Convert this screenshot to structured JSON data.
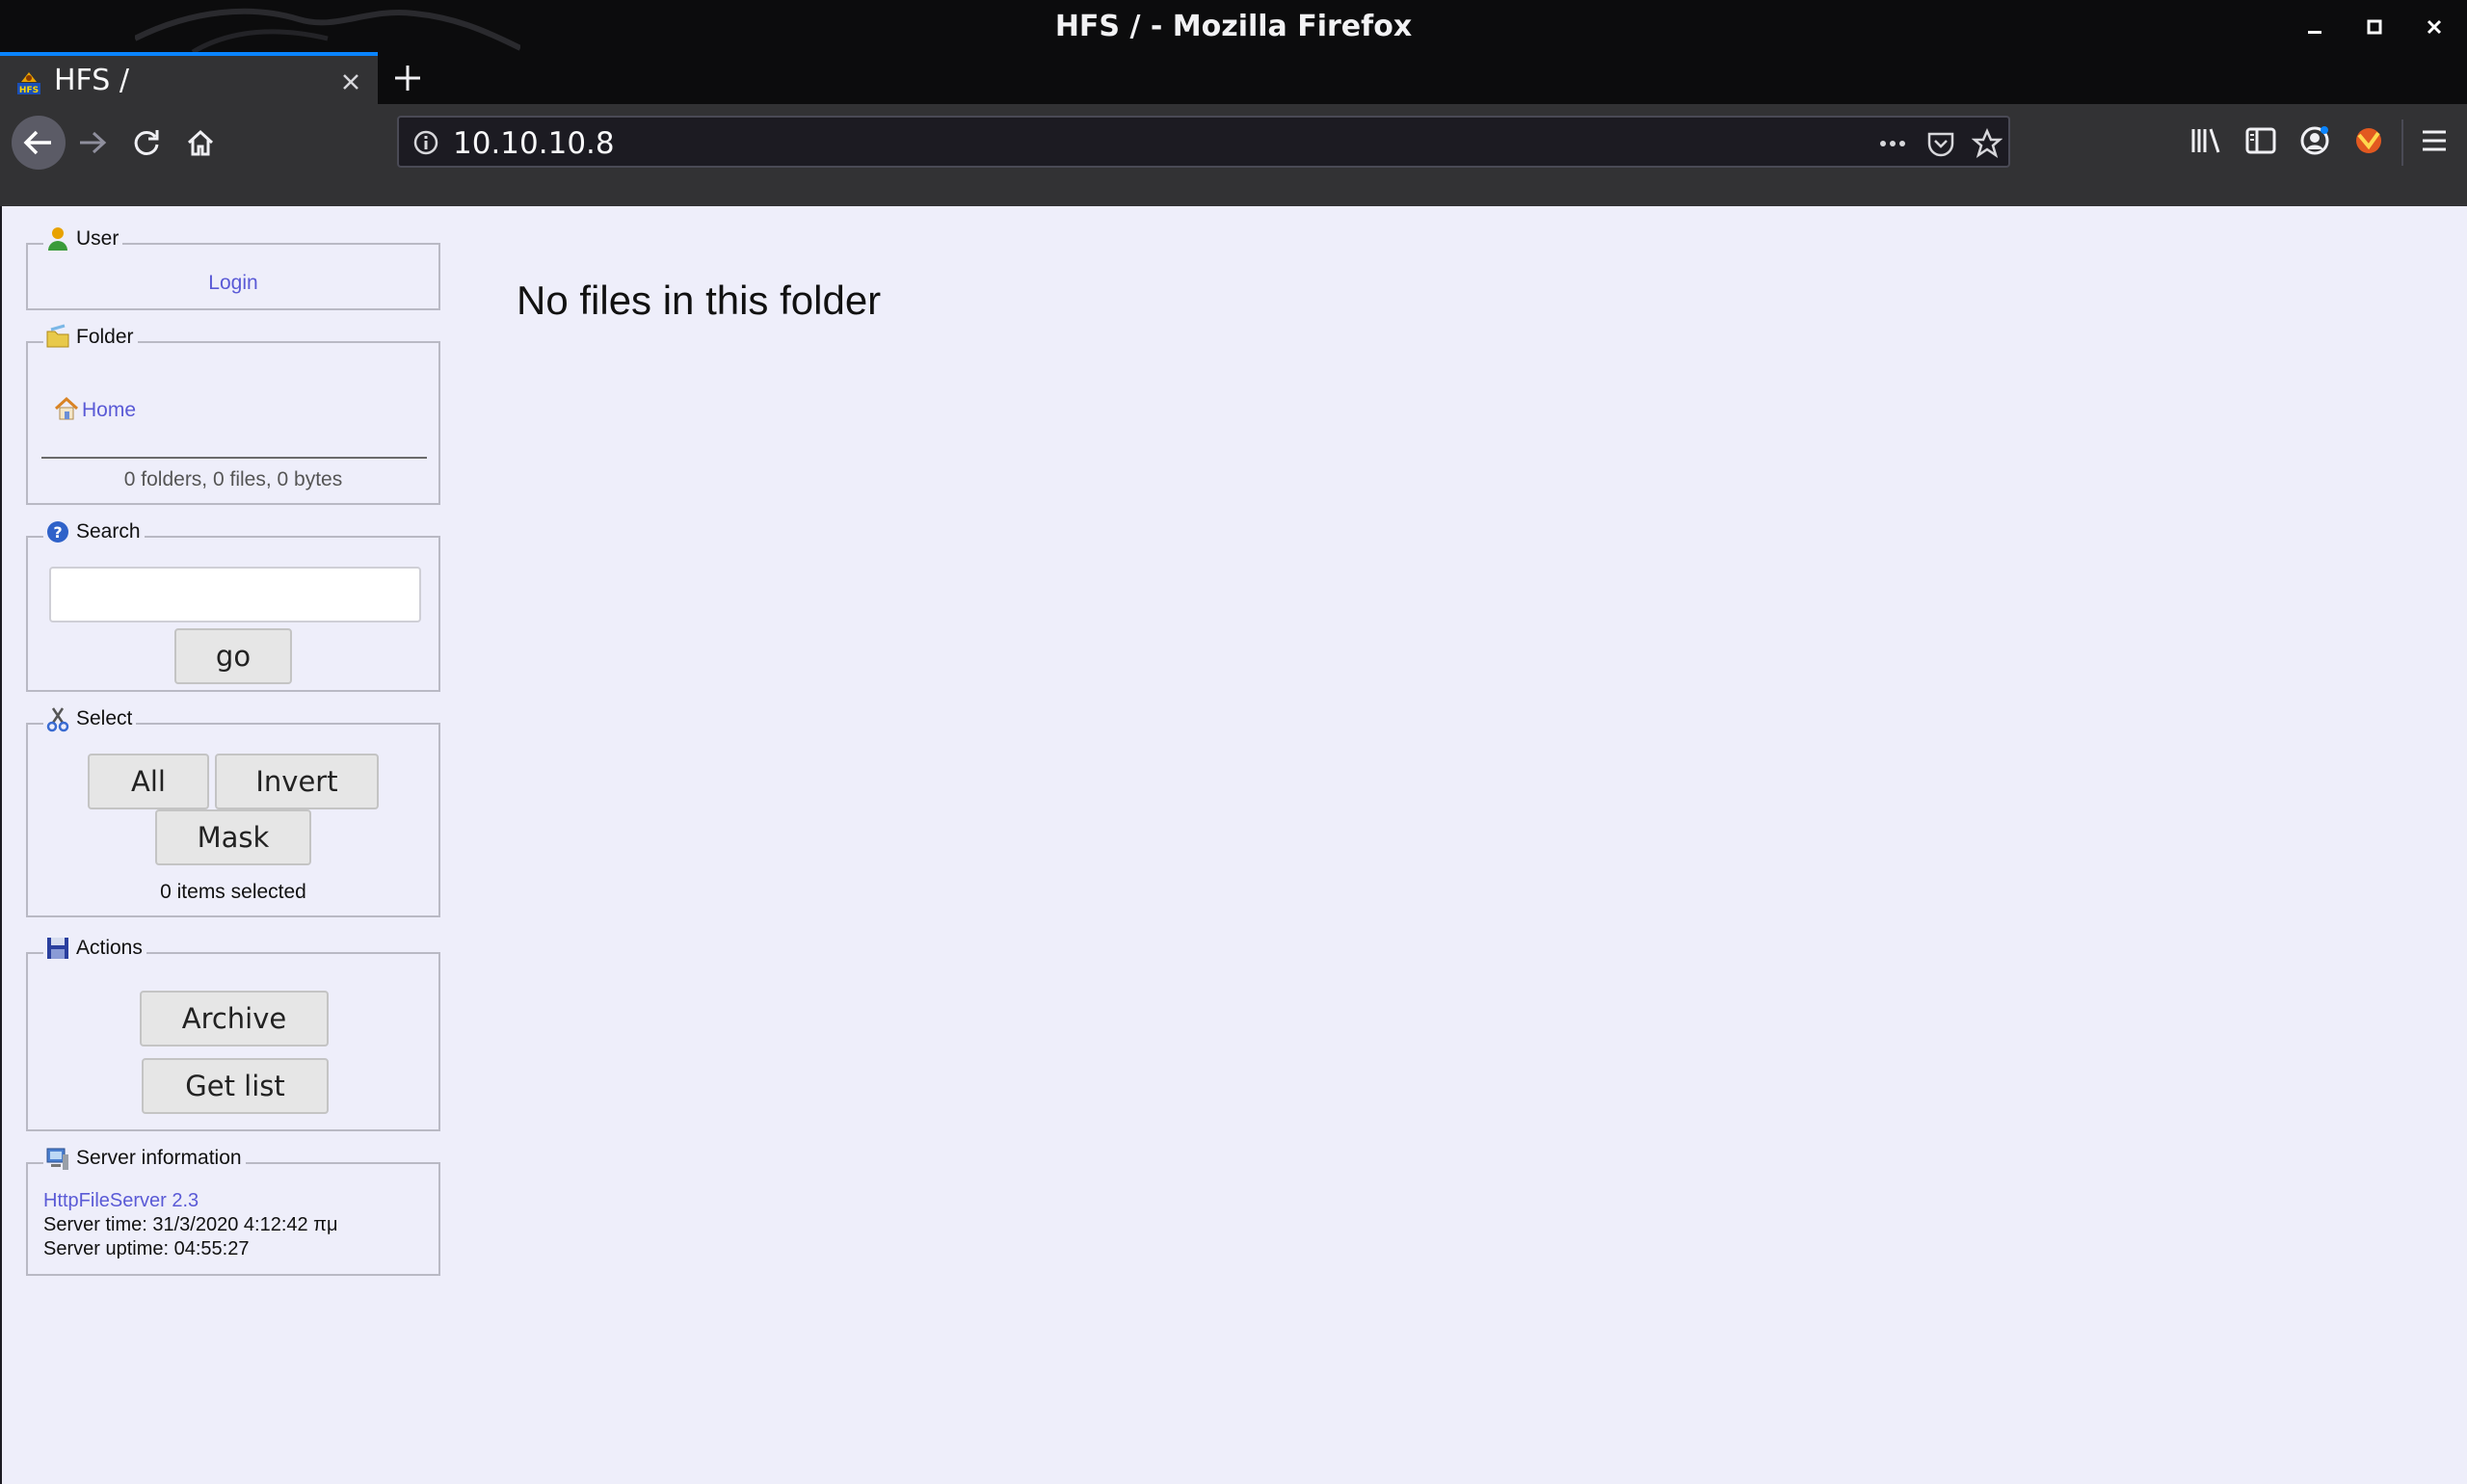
{
  "window": {
    "title": "HFS / - Mozilla Firefox"
  },
  "tab": {
    "title": "HFS /",
    "favicon_label": "HFS"
  },
  "urlbar": {
    "url": "10.10.10.8"
  },
  "colors": {
    "chrome_dark": "#0c0c0d",
    "toolbar": "#323234",
    "tab_accent": "#0a84ff",
    "page_bg": "#eeeefa",
    "link": "#5a5ad6"
  },
  "page": {
    "heading": "No files in this folder",
    "user": {
      "legend": "User",
      "login_link": "Login"
    },
    "folder": {
      "legend": "Folder",
      "home_link": "Home",
      "summary": "0 folders, 0 files, 0 bytes"
    },
    "search": {
      "legend": "Search",
      "value": "",
      "go_label": "go"
    },
    "select": {
      "legend": "Select",
      "all_label": "All",
      "invert_label": "Invert",
      "mask_label": "Mask",
      "status": "0 items selected"
    },
    "actions": {
      "legend": "Actions",
      "archive_label": "Archive",
      "getlist_label": "Get list"
    },
    "server": {
      "legend": "Server information",
      "version_link": "HttpFileServer 2.3",
      "time": "Server time: 31/3/2020 4:12:42 πμ",
      "uptime": "Server uptime: 04:55:27"
    }
  }
}
